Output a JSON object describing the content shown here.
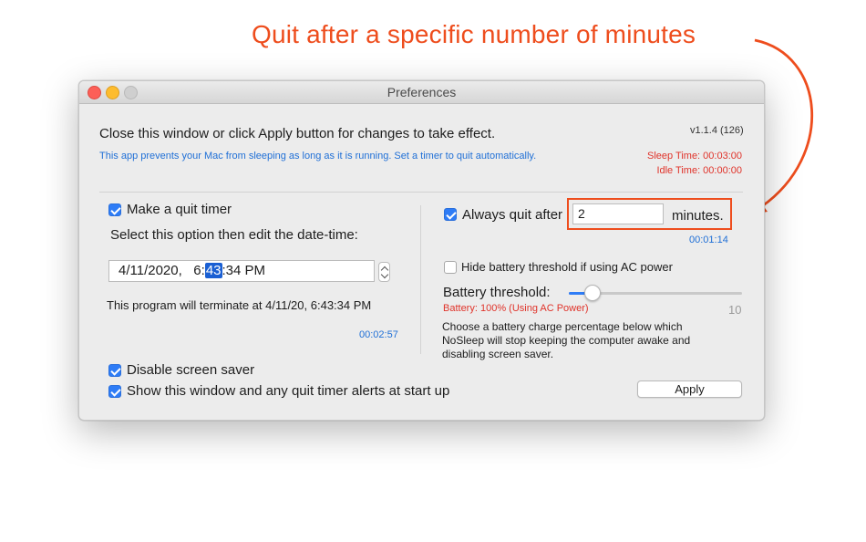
{
  "annotation": {
    "text": "Quit after a specific number of minutes",
    "color": "#ee4d1d"
  },
  "window": {
    "title": "Preferences",
    "header_message": "Close this window or click Apply button for changes to take effect.",
    "version": "v1.1.4 (126)",
    "info": "This app prevents your Mac from sleeping as long as it is running. Set a timer to quit automatically.",
    "sleep_time": "Sleep Time: 00:03:00",
    "idle_time": "Idle Time: 00:00:00"
  },
  "left": {
    "quit_timer_label": "Make a quit timer",
    "quit_timer_checked": true,
    "select_hint": "Select this option then edit the date-time:",
    "datetime_prefix": "4/11/2020,   6:",
    "datetime_selected": "43",
    "datetime_suffix": ":34 PM",
    "terminate_message": "This program will terminate at 4/11/20, 6:43:34 PM",
    "countdown": "00:02:57"
  },
  "right": {
    "always_quit_label": "Always quit after",
    "always_quit_checked": true,
    "minutes_value": "2",
    "minutes_label": "minutes.",
    "countdown": "00:01:14",
    "hide_battery_label": "Hide battery threshold if using AC power",
    "hide_battery_checked": false,
    "battery_threshold_label": "Battery threshold:",
    "battery_status": "Battery: 100% (Using AC Power)",
    "slider_value": 10,
    "slider_display": "10",
    "description": "Choose a battery charge percentage below which NoSleep will stop keeping the computer awake and disabling screen saver."
  },
  "bottom": {
    "disable_saver_label": "Disable screen saver",
    "disable_saver_checked": true,
    "show_window_label": "Show this window and any quit timer alerts at start up",
    "show_window_checked": true,
    "apply_label": "Apply"
  },
  "colors": {
    "accent": "#2e7cf6",
    "link_blue": "#1f6fd6",
    "alert_red": "#e0332a"
  }
}
